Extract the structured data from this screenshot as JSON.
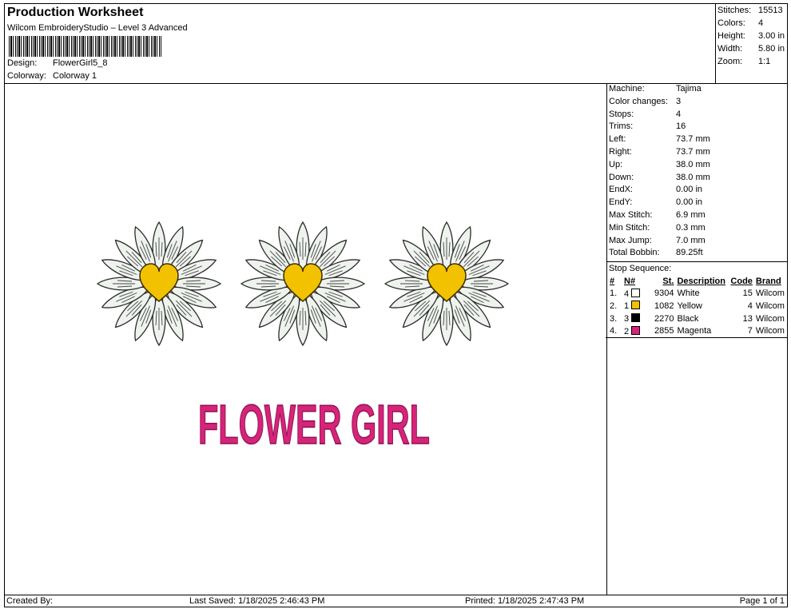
{
  "header": {
    "title": "Production Worksheet",
    "software": "Wilcom EmbroideryStudio – Level 3 Advanced",
    "design_label": "Design:",
    "design_value": "FlowerGirl5_8",
    "colorway_label": "Colorway:",
    "colorway_value": "Colorway 1"
  },
  "stats": [
    {
      "label": "Stitches:",
      "value": "15513"
    },
    {
      "label": "Colors:",
      "value": "4"
    },
    {
      "label": "Height:",
      "value": "3.00 in"
    },
    {
      "label": "Width:",
      "value": "5.80 in"
    },
    {
      "label": "Zoom:",
      "value": "1:1"
    }
  ],
  "machine_info": [
    {
      "label": "Machine:",
      "value": "Tajima"
    },
    {
      "label": "Color changes:",
      "value": "3"
    },
    {
      "label": "Stops:",
      "value": "4"
    },
    {
      "label": "Trims:",
      "value": "16"
    },
    {
      "label": "Left:",
      "value": "73.7 mm"
    },
    {
      "label": "Right:",
      "value": "73.7 mm"
    },
    {
      "label": "Up:",
      "value": "38.0 mm"
    },
    {
      "label": "Down:",
      "value": "38.0 mm"
    },
    {
      "label": "EndX:",
      "value": "0.00 in"
    },
    {
      "label": "EndY:",
      "value": "0.00 in"
    },
    {
      "label": "Max Stitch:",
      "value": "6.9 mm"
    },
    {
      "label": "Min Stitch:",
      "value": "0.3 mm"
    },
    {
      "label": "Max Jump:",
      "value": "7.0 mm"
    },
    {
      "label": "Total Bobbin:",
      "value": "89.25ft"
    }
  ],
  "stop_sequence": {
    "caption": "Stop Sequence:",
    "headers": {
      "num": "#",
      "n": "N#",
      "st": "St.",
      "desc": "Description",
      "code": "Code",
      "brand": "Brand"
    },
    "rows": [
      {
        "num": "1.",
        "n": "4",
        "color": "#ffffff",
        "st": "9304",
        "desc": "White",
        "code": "15",
        "brand": "Wilcom"
      },
      {
        "num": "2.",
        "n": "1",
        "color": "#f2c200",
        "st": "1082",
        "desc": "Yellow",
        "code": "4",
        "brand": "Wilcom"
      },
      {
        "num": "3.",
        "n": "3",
        "color": "#000000",
        "st": "2270",
        "desc": "Black",
        "code": "13",
        "brand": "Wilcom"
      },
      {
        "num": "4.",
        "n": "2",
        "color": "#d6247a",
        "st": "2855",
        "desc": "Magenta",
        "code": "7",
        "brand": "Wilcom"
      }
    ]
  },
  "design": {
    "text": "FLOWER GIRL",
    "text_color": "#d6247a",
    "petal_color": "#eef3ee",
    "center_color": "#f2c200"
  },
  "footer": {
    "created_by": "Created By:",
    "last_saved": "Last Saved: 1/18/2025 2:46:43 PM",
    "printed": "Printed: 1/18/2025 2:47:43 PM",
    "page": "Page 1 of 1"
  }
}
